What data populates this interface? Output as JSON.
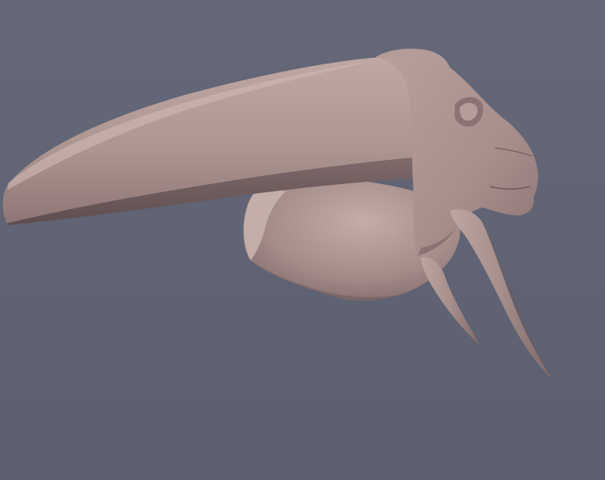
{
  "viewport": {
    "background_color": "#5f6373",
    "model": {
      "name": "",
      "surface_color": "#ab9390",
      "highlight_color": "#c4aca8",
      "shadow_color": "#6f5a5b"
    }
  }
}
